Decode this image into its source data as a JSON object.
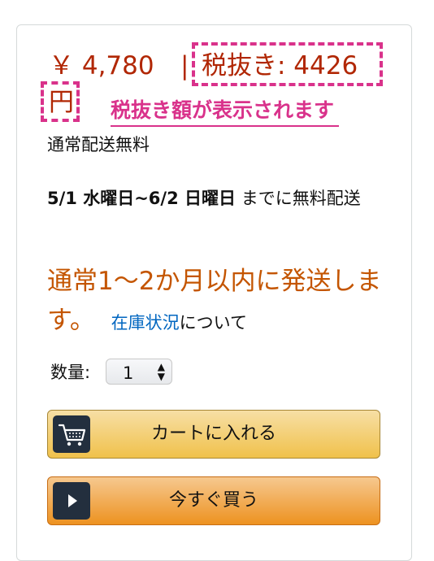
{
  "price": {
    "amount": "￥ 4,780",
    "separator": "|",
    "tax_excluded": "税抜き: 4426",
    "tax_excluded_unit": "円"
  },
  "annotation": {
    "note": "税抜き額が表示されます",
    "color": "#d9328b"
  },
  "shipping": {
    "free_label": "通常配送無料",
    "delivery_dates": "5/1 水曜日~6/2 日曜日",
    "delivery_suffix": " までに無料配送"
  },
  "availability": {
    "text": "通常1～2か月以内に発送します。",
    "link": "在庫状況",
    "link_suffix": "について"
  },
  "quantity": {
    "label": "数量:",
    "value": "1"
  },
  "buttons": {
    "add_to_cart": "カートに入れる",
    "buy_now": "今すぐ買う"
  },
  "colors": {
    "price": "#b12704",
    "availability": "#c45500",
    "link": "#0066c0"
  },
  "icons": {
    "cart": "cart-icon",
    "play": "play-icon",
    "select_arrows": "updown-arrows-icon"
  }
}
